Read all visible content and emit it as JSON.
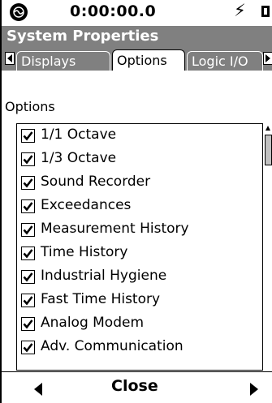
{
  "status": {
    "clock": "0:00:00.0"
  },
  "header": {
    "title": "System Properties"
  },
  "tabs": [
    {
      "label": "Displays",
      "selected": false
    },
    {
      "label": "Options",
      "selected": true
    },
    {
      "label": "Logic I/O",
      "selected": false
    }
  ],
  "section_label": "Options",
  "options": [
    {
      "label": "1/1 Octave",
      "checked": true
    },
    {
      "label": "1/3 Octave",
      "checked": true
    },
    {
      "label": "Sound Recorder",
      "checked": true
    },
    {
      "label": "Exceedances",
      "checked": true
    },
    {
      "label": "Measurement History",
      "checked": true
    },
    {
      "label": "Time History",
      "checked": true
    },
    {
      "label": "Industrial Hygiene",
      "checked": true
    },
    {
      "label": "Fast Time History",
      "checked": true
    },
    {
      "label": "Analog Modem",
      "checked": true
    },
    {
      "label": "Adv. Communication",
      "checked": true
    }
  ],
  "bottom": {
    "close_label": "Close"
  },
  "icons": {
    "logo": "app-logo-icon",
    "power": "lightning-icon",
    "battery": "battery-icon",
    "check": "checkmark-icon"
  },
  "colors": {
    "header_bg": "#808080",
    "header_text": "#ffffff",
    "selected_tab_bg": "#ffffff"
  }
}
